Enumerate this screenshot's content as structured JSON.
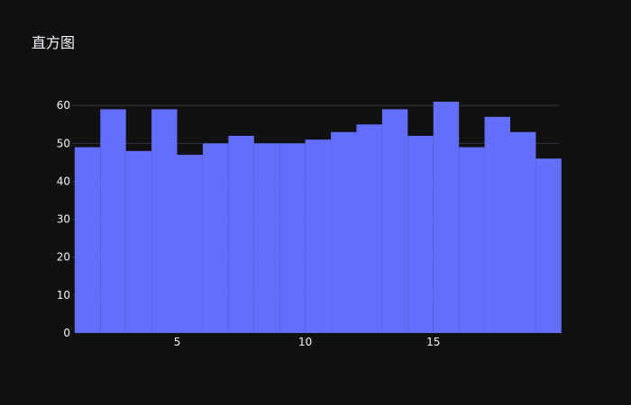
{
  "colors": {
    "background": "#111111",
    "bar": "#636efa",
    "grid": "#283442",
    "text": "#f2f5fa"
  },
  "chart_data": {
    "type": "bar",
    "title": "直方图",
    "xlabel": "",
    "ylabel": "",
    "x_bin_start": [
      1,
      2,
      3,
      4,
      5,
      6,
      7,
      8,
      9,
      10,
      11,
      12,
      13,
      14,
      15,
      16,
      17,
      18,
      19
    ],
    "bin_width": 1,
    "values": [
      49,
      59,
      48,
      59,
      47,
      50,
      52,
      50,
      50,
      51,
      53,
      55,
      59,
      52,
      61,
      49,
      57,
      53,
      46
    ],
    "xlim": [
      0.9,
      19.9
    ],
    "ylim": [
      0,
      61
    ],
    "x_ticks": [
      5,
      10,
      15
    ],
    "y_ticks": [
      0,
      10,
      20,
      30,
      40,
      50,
      60
    ],
    "grid": true,
    "legend": "none"
  }
}
